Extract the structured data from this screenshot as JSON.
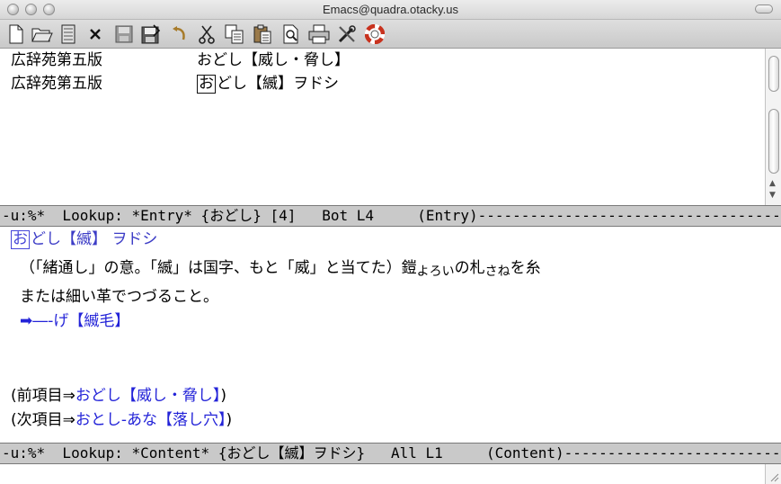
{
  "window": {
    "title": "Emacs@quadra.otacky.us"
  },
  "toolbar": {
    "items": [
      "new-file-icon",
      "open-folder-icon",
      "open-file-icon",
      "close-icon",
      "save-icon",
      "save-as-icon",
      "undo-icon",
      "cut-icon",
      "copy-icon",
      "paste-icon",
      "search-icon",
      "print-icon",
      "preferences-icon",
      "help-icon"
    ]
  },
  "entry_pane": {
    "rows": [
      {
        "dict": "広辞苑第五版",
        "cursor": "",
        "headword": "おどし【威し・脅し】"
      },
      {
        "dict": "広辞苑第五版",
        "cursor": "お",
        "headword": "どし【縅】ヲドシ"
      }
    ]
  },
  "entry_modeline": {
    "text": "-u:%*  Lookup: *Entry* {おどし} [4]   Bot L4     (Entry)------------------------------------------------"
  },
  "content_pane": {
    "heading_cursor": "お",
    "heading_rest": "どし【縅】",
    "heading_reading": "ヲドシ",
    "body_line1_a": "（「緒通し」の意。「縅」は国字、もと「威」と当てた）鎧",
    "body_ruby1": "よろい",
    "body_line1_b": "の札",
    "body_ruby2": "さね",
    "body_line1_c": "を糸",
    "body_line2": "または細い革でつづること。",
    "link_arrow": "➡",
    "link_text": "―‐げ【縅毛】",
    "prev_label": "(前項目⇒",
    "prev_link": "おどし【威し・脅し】",
    "prev_close": ")",
    "next_label": "(次項目⇒",
    "next_link": "おとし‐あな【落し穴】",
    "next_close": ")"
  },
  "content_modeline": {
    "text": "-u:%*  Lookup: *Content* {おどし【縅】ヲドシ}   All L1     (Content)-----------------------------"
  },
  "colors": {
    "link": "#2323d8",
    "heading": "#3c3cc6",
    "modeline_bg": "#c9c9c9"
  }
}
